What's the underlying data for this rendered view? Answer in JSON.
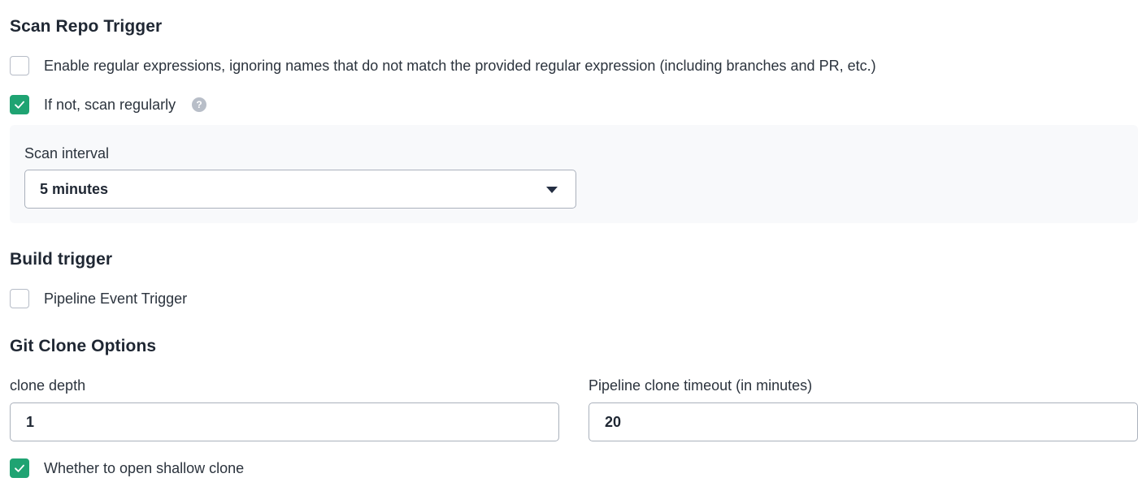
{
  "scan_repo_trigger": {
    "title": "Scan Repo Trigger",
    "regex_option": {
      "label": "Enable regular expressions, ignoring names that do not match the provided regular expression (including branches and PR, etc.)",
      "checked": false
    },
    "scan_regularly_option": {
      "label": "If not, scan regularly",
      "checked": true,
      "help_icon": "?"
    },
    "scan_interval": {
      "label": "Scan interval",
      "selected": "5 minutes"
    }
  },
  "build_trigger": {
    "title": "Build trigger",
    "pipeline_event_option": {
      "label": "Pipeline Event Trigger",
      "checked": false
    }
  },
  "git_clone_options": {
    "title": "Git Clone Options",
    "clone_depth": {
      "label": "clone depth",
      "value": "1"
    },
    "clone_timeout": {
      "label": "Pipeline clone timeout (in minutes)",
      "value": "20"
    },
    "shallow_clone_option": {
      "label": "Whether to open shallow clone",
      "checked": true
    }
  },
  "colors": {
    "accent_green": "#1fa372",
    "border": "#aab1bc",
    "panel_bg": "#f8f9fb"
  }
}
